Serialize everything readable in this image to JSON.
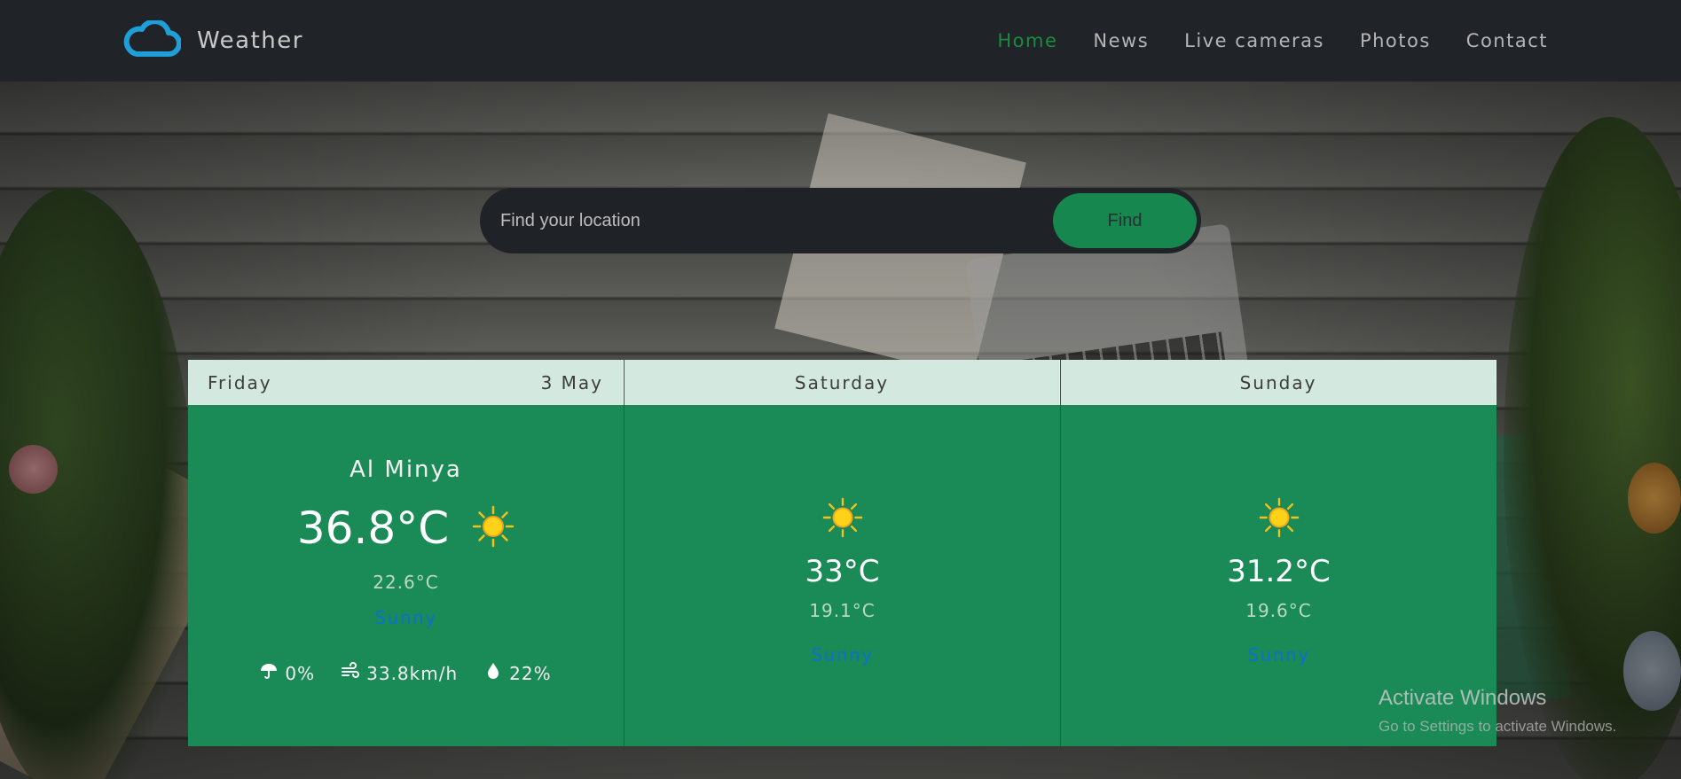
{
  "navbar": {
    "brand": "Weather",
    "links": [
      {
        "label": "Home",
        "active": true
      },
      {
        "label": "News",
        "active": false
      },
      {
        "label": "Live cameras",
        "active": false
      },
      {
        "label": "Photos",
        "active": false
      },
      {
        "label": "Contact",
        "active": false
      }
    ]
  },
  "search": {
    "placeholder": "Find your location",
    "value": "",
    "button_label": "Find"
  },
  "forecast": {
    "today": {
      "day": "Friday",
      "date": "3 May",
      "city": "Al Minya",
      "temp": "36.8°C",
      "low": "22.6°C",
      "condition": "Sunny",
      "icon": "sun-icon",
      "rain": "0%",
      "wind": "33.8km/h",
      "humidity": "22%"
    },
    "day2": {
      "day": "Saturday",
      "temp": "33°C",
      "low": "19.1°C",
      "condition": "Sunny",
      "icon": "sun-icon"
    },
    "day3": {
      "day": "Sunday",
      "temp": "31.2°C",
      "low": "19.6°C",
      "condition": "Sunny",
      "icon": "sun-icon"
    }
  },
  "watermark": {
    "title": "Activate Windows",
    "subtitle": "Go to Settings to activate Windows."
  },
  "colors": {
    "navbar": "#202328",
    "accent_green": "#1a8a56",
    "active_link": "#1a8a3e",
    "card_header": "#d3e8de",
    "condition_text": "#0d6fcf",
    "logo_blue": "#1e9fd8"
  }
}
